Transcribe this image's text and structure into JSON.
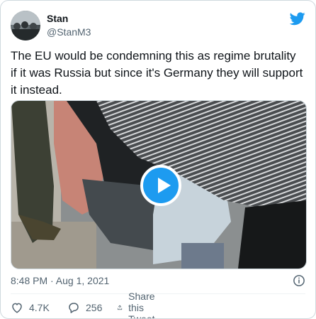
{
  "tweet": {
    "author_name": "Stan",
    "author_handle": "@StanM3",
    "text": "The EU would be condemning this as regime brutality if it was Russia but since it's Germany they will support it instead.",
    "timestamp": "8:48 PM · Aug 1, 2021"
  },
  "actions": {
    "likes": "4.7K",
    "replies": "256",
    "share_label": "Share this Tweet"
  },
  "colors": {
    "accent": "#1d9bf0",
    "secondary_text": "#536471",
    "border": "#cfd9de"
  },
  "icons": [
    "twitter-bird-icon",
    "play-icon",
    "info-icon",
    "heart-icon",
    "reply-icon",
    "share-icon"
  ]
}
